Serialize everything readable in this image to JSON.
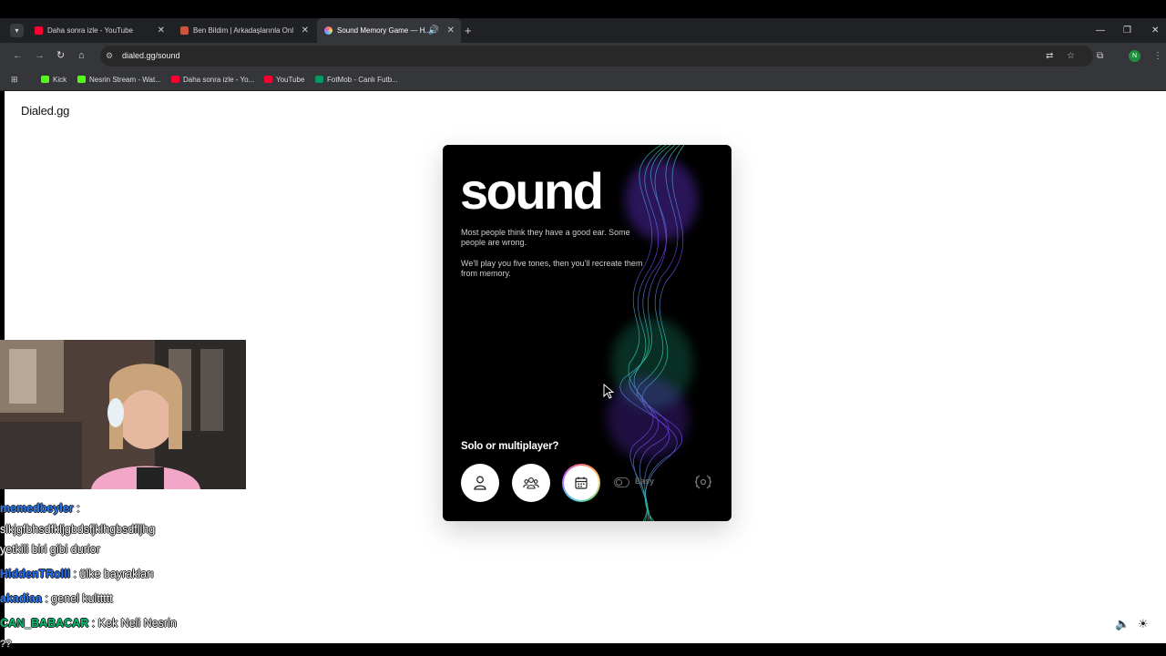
{
  "browser": {
    "tabs": [
      {
        "title": "Daha sonra izle - YouTube",
        "favicon_color": "#ff0033",
        "active": false
      },
      {
        "title": "Ben Bildim | Arkadaşlarınla Onli...",
        "favicon_color": "#c8553d",
        "active": false
      },
      {
        "title": "Sound Memory Game — H...",
        "favicon_color": "#4cc9f0",
        "active": true
      }
    ],
    "new_tab": "+",
    "url": "dialed.gg/sound",
    "bookmarks": [
      {
        "label": "Kick",
        "color": "#53fc18"
      },
      {
        "label": "Nesrin Stream - Wat...",
        "color": "#53fc18"
      },
      {
        "label": "Daha sonra izle - Yo...",
        "color": "#ff0033"
      },
      {
        "label": "YouTube",
        "color": "#ff0033"
      },
      {
        "label": "FotMob - Canlı Futb...",
        "color": "#00985f"
      }
    ],
    "profile_initial": "N"
  },
  "site": {
    "brand": "Dialed.gg"
  },
  "game": {
    "title": "sound",
    "intro_1": "Most people think they have a good ear. Some people are wrong.",
    "intro_2": "We'll play you five tones, then you'll recreate them from memory.",
    "mode_question": "Solo or multiplayer?",
    "modes": [
      "solo-mode",
      "multiplayer-mode",
      "daily-mode"
    ],
    "difficulty_label": "Easy",
    "colors": {
      "card_bg": "#000000",
      "wave_teal": "#2ee6b0",
      "wave_purple": "#7a3cff"
    }
  },
  "stream_overlay": {
    "chat": [
      {
        "user": "memedbeyler",
        "user_color": "#2a7fff",
        "message": " :"
      },
      {
        "user": "",
        "user_color": "#ffffff",
        "message": "slkjgfbhsdfkljgbdsfjklhgbsdfljhg"
      },
      {
        "user": "",
        "user_color": "#ffffff",
        "message": "yetkili biri gibi durior"
      },
      {
        "user": "HiddenTRolll",
        "user_color": "#1e6fff",
        "message": " : ülke bayrakları"
      },
      {
        "user": "akadiaa",
        "user_color": "#2a7fff",
        "message": " : genel kulttttt"
      },
      {
        "user": "CAN_BABACAR",
        "user_color": "#00c26e",
        "message": " : Kek Neli Nesrin"
      },
      {
        "user": "",
        "user_color": "#ffffff",
        "message": "??"
      }
    ]
  }
}
